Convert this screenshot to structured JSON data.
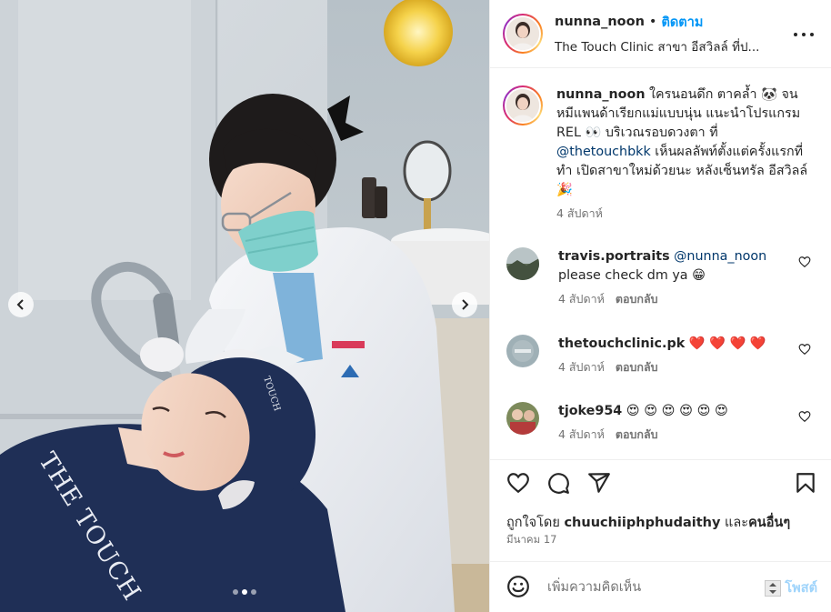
{
  "post": {
    "username": "nunna_noon",
    "follow_label": "ติดตาม",
    "separator": "•",
    "location": "The Touch Clinic สาขา อีสวิลล์ ที่ป..."
  },
  "photo": {
    "brand_text": "THE TOUCH",
    "cap_text": "TOUCH",
    "carousel_count": 3,
    "carousel_active": 1
  },
  "caption": {
    "username": "nunna_noon",
    "text_1": " ใครนอนดึก ตาคล้ำ 🐼 จนหมีแพนด้าเรียกแม่แบบนุ่น แนะนำโปรแกรม REL 👀 บริเวณรอบดวงตา ที่ ",
    "mention": "@thetouchbkk",
    "text_2": " เห็นผลลัพท์ตั้งแต่ครั้งแรกที่ทำ เปิดสาขาใหม่ด้วยนะ หลังเซ็นทรัล อีสวิลล์ 🎉",
    "time": "4 สัปดาห์"
  },
  "comments": [
    {
      "username": "travis.portraits",
      "mention": "@nunna_noon",
      "text": "please check dm ya 😁",
      "time": "4 สัปดาห์",
      "reply": "ตอบกลับ"
    },
    {
      "username": "thetouchclinic.pk",
      "mention": "",
      "text": " ❤️ ❤️ ❤️ ❤️",
      "time": "4 สัปดาห์",
      "reply": "ตอบกลับ"
    },
    {
      "username": "tjoke954",
      "mention": "",
      "text": " 😍 😍 😍 😍 😍 😍",
      "time": "4 สัปดาห์",
      "reply": "ตอบกลับ"
    }
  ],
  "likes": {
    "prefix": "ถูกใจโดย ",
    "user": "chuuchiiphphudaithy",
    "middle": " และ",
    "others": "คนอื่นๆ"
  },
  "date": "มีนาคม 17",
  "add_comment": {
    "placeholder": "เพิ่มความคิดเห็น",
    "post_label": "โพสต์"
  },
  "colors": {
    "accent": "#0095f6",
    "text": "#262626",
    "secondary": "#737373",
    "scrub_navy": "#1f2f56"
  },
  "icons": [
    "more-icon",
    "heart-icon",
    "comment-icon",
    "share-icon",
    "bookmark-icon",
    "emoji-icon",
    "chevron-left-icon",
    "chevron-right-icon"
  ]
}
